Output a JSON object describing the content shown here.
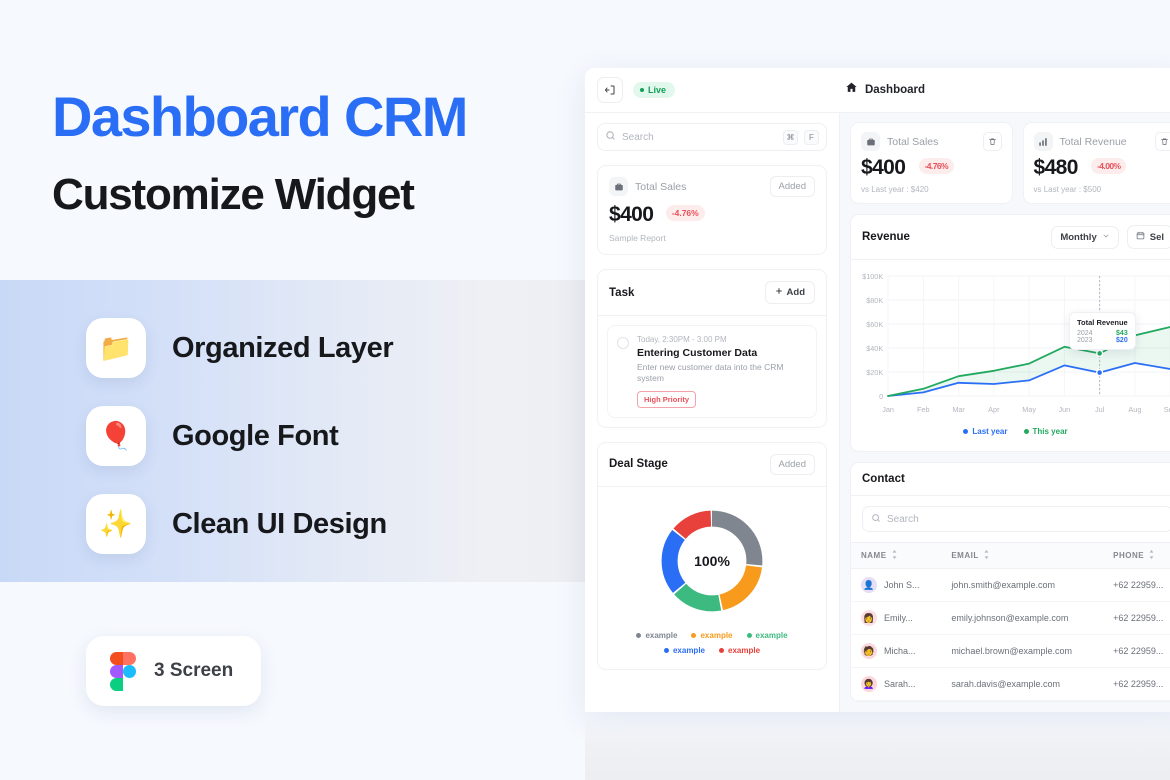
{
  "promo": {
    "title": "Dashboard CRM",
    "subtitle": "Customize Widget",
    "title_color": "#2b6ef6",
    "features": [
      {
        "icon": "📁",
        "icon_name": "folder-icon",
        "label": "Organized Layer"
      },
      {
        "icon": "🎈",
        "icon_name": "balloon-icon",
        "label": "Google Font"
      },
      {
        "icon": "✨",
        "icon_name": "sparkles-icon",
        "label": "Clean UI Design"
      }
    ],
    "badge": {
      "label": "3 Screen",
      "logo": "figma-logo"
    }
  },
  "app": {
    "topbar": {
      "collapse_icon": "sidebar-collapse-icon",
      "live_label": "Live",
      "live_color": "#13a05a",
      "home_icon": "home-icon",
      "page_label": "Dashboard"
    },
    "widget_panel": {
      "search": {
        "placeholder": "Search",
        "icon": "search-icon",
        "kbd1": "⌘",
        "kbd2": "F"
      },
      "total_sales_widget": {
        "icon": "briefcase-icon",
        "title": "Total Sales",
        "action_label": "Added",
        "value": "$400",
        "delta": "-4.76%",
        "delta_color": "#e8505b",
        "note": "Sample Report"
      },
      "task_section": {
        "title": "Task",
        "add_label": "Add",
        "item": {
          "time": "Today, 2:30PM - 3.00 PM",
          "name": "Entering Customer Data",
          "desc": "Enter new customer data into the CRM system",
          "priority": "High Priority"
        }
      },
      "deal_stage": {
        "title": "Deal Stage",
        "action_label": "Added",
        "center_label": "100%",
        "legend": [
          {
            "label": "example",
            "color": "#808690"
          },
          {
            "label": "example",
            "color": "#f89b1c"
          },
          {
            "label": "example",
            "color": "#3dba7f"
          },
          {
            "label": "example",
            "color": "#2b6ef6"
          },
          {
            "label": "example",
            "color": "#e8403a"
          }
        ]
      }
    },
    "kpis": [
      {
        "icon": "briefcase-icon",
        "title": "Total Sales",
        "value": "$400",
        "delta": "-4.76%",
        "note": "vs Last year : $420",
        "delete_icon": "trash-icon"
      },
      {
        "icon": "bar-chart-icon",
        "title": "Total Revenue",
        "value": "$480",
        "delta": "-4.00%",
        "note": "vs Last year : $500",
        "delete_icon": "trash-icon"
      }
    ],
    "revenue_panel": {
      "title": "Revenue",
      "period_label": "Monthly",
      "date_label": "Sel",
      "calendar_icon": "calendar-icon",
      "chevron_icon": "chevron-down-icon",
      "tooltip": {
        "title": "Total Revenue",
        "rows": [
          {
            "year": "2024",
            "value": "$43",
            "color": "#22a95f"
          },
          {
            "year": "2023",
            "value": "$20",
            "color": "#2b6ef6"
          }
        ]
      }
    },
    "contact_panel": {
      "title": "Contact",
      "search": {
        "placeholder": "Search",
        "icon": "search-icon"
      },
      "columns": [
        {
          "label": "NAME",
          "sort_icon": "sort-icon"
        },
        {
          "label": "EMAIL",
          "sort_icon": "sort-icon"
        },
        {
          "label": "PHONE",
          "sort_icon": "sort-icon"
        }
      ],
      "rows": [
        {
          "name": "John S...",
          "email": "john.smith@example.com",
          "phone": "+62 22959...",
          "avatar_bg": "#e7ddf4",
          "avatar": "👤"
        },
        {
          "name": "Emily...",
          "email": "emily.johnson@example.com",
          "phone": "+62 22959...",
          "avatar_bg": "#fbdde6",
          "avatar": "👩"
        },
        {
          "name": "Micha...",
          "email": "michael.brown@example.com",
          "phone": "+62 22959...",
          "avatar_bg": "#fbd7de",
          "avatar": "🧑"
        },
        {
          "name": "Sarah...",
          "email": "sarah.davis@example.com",
          "phone": "+62 22959...",
          "avatar_bg": "#fbd7dd",
          "avatar": "👩‍🦱"
        }
      ]
    }
  },
  "chart_data": [
    {
      "type": "line",
      "title": "Revenue",
      "xlabel": "",
      "ylabel": "",
      "x": [
        "Jan",
        "Feb",
        "Mar",
        "Apr",
        "May",
        "Jun",
        "Jul",
        "Aug",
        "Sep"
      ],
      "ytick_labels": [
        "0",
        "$20K",
        "$40K",
        "$60K",
        "$80K",
        "$100K"
      ],
      "ylim": [
        0,
        100000
      ],
      "grid": true,
      "legend_position": "bottom",
      "series": [
        {
          "name": "Last year",
          "color": "#2b6ef6",
          "values": [
            0,
            3000,
            11000,
            10000,
            13000,
            25500,
            19500,
            27500,
            22500
          ]
        },
        {
          "name": "This year",
          "color": "#22a95f",
          "values": [
            0,
            6000,
            16500,
            21000,
            27000,
            41000,
            35500,
            50500,
            57500
          ]
        }
      ],
      "marker_at": "Jul",
      "annotation": {
        "title": "Total Revenue",
        "2024": "$43",
        "2023": "$20"
      }
    },
    {
      "type": "pie",
      "title": "Deal Stage",
      "center_label": "100%",
      "labels": [
        "example",
        "example",
        "example",
        "example",
        "example"
      ],
      "values": [
        27,
        20,
        17,
        22,
        14
      ],
      "colors": [
        "#808690",
        "#f89b1c",
        "#3dba7f",
        "#2b6ef6",
        "#e8403a"
      ],
      "legend_position": "bottom"
    }
  ]
}
